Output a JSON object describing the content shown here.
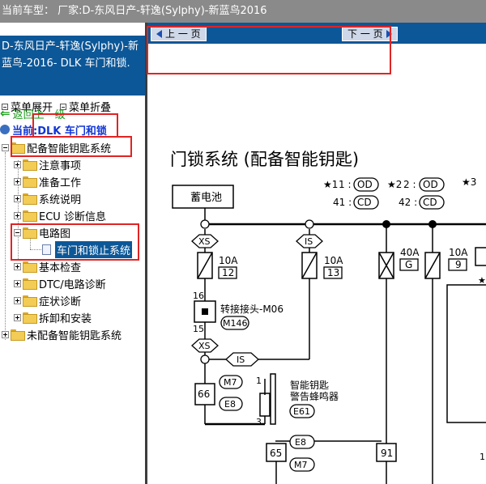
{
  "topbar": {
    "text": "当前车型：  厂家:D-东风日产-轩逸(Sylphy)-新蓝鸟2016"
  },
  "left": {
    "model_line1": "D-东风日产-轩逸(Sylphy)-新",
    "model_line2": "蓝鸟-2016- DLK 车门和锁.",
    "expand_label": "菜单展开",
    "collapse_label": "菜单折叠",
    "back_label": "返回上一级",
    "current_label": "当前:DLK 车门和锁",
    "tree": {
      "root1": "配备智能钥匙系统",
      "items": [
        "注意事项",
        "准备工作",
        "系统说明",
        "ECU 诊断信息"
      ],
      "circuit": "电路图",
      "circuit_child": "车门和锁止系统",
      "items2": [
        "基本检查",
        "DTC/电路诊断",
        "症状诊断",
        "拆卸和安装"
      ],
      "root2": "未配备智能钥匙系统"
    }
  },
  "nav": {
    "prev_label": "上 一 页",
    "next_label": "下 一 页"
  },
  "diagram": {
    "title": "门锁系统 (配备智能钥匙)",
    "battery": "蓄电池",
    "legend": [
      {
        "mark": "★1",
        "num": "1 :",
        "code": "OD"
      },
      {
        "mark": "★2",
        "num": "2 :",
        "code": "OD"
      },
      {
        "mark": "",
        "num": "41 :",
        "code": "CD"
      },
      {
        "mark": "",
        "num": "42 :",
        "code": "CD"
      }
    ],
    "legend_extra": "★3",
    "xs": "XS",
    "is": "IS",
    "fuse1_amp": "10A",
    "fuse1_no": "12",
    "fuse2_amp": "10A",
    "fuse2_no": "13",
    "fuse3_amp": "40A",
    "fuse3_no": "G",
    "fuse4_amp": "10A",
    "fuse4_no": "9",
    "pin16": "16",
    "pin15": "15",
    "joint_label": "转接接头-M06",
    "m146": "M146",
    "m7": "M7",
    "e8": "E8",
    "pin66": "66",
    "pin1": "1",
    "pin3": "3",
    "buzzer_label1": "智能钥匙",
    "buzzer_label2": "警告蜂鸣器",
    "e61": "E61",
    "pin65": "65",
    "pin91": "91",
    "edge_mark": "★",
    "edge_num": "1"
  }
}
